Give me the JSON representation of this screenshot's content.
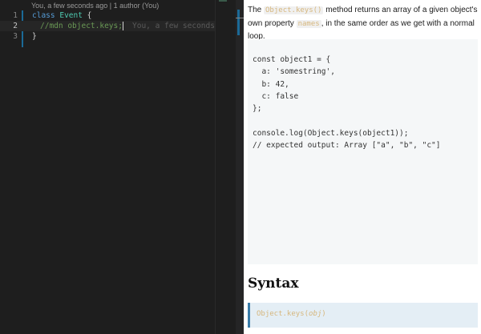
{
  "editor": {
    "blame_header": "You, a few seconds ago | 1 author (You)",
    "lines": [
      {
        "num": "1",
        "keyword": "class",
        "name": "Event",
        "rest": " {"
      },
      {
        "num": "2",
        "comment": "//mdn object.keys;",
        "inline_blame": "You, a few seconds ago"
      },
      {
        "num": "3",
        "text": "}"
      }
    ]
  },
  "doc": {
    "intro_before": "The ",
    "intro_code1": "Object.keys()",
    "intro_mid": " method returns an array of a given object's own property ",
    "intro_code2": "names",
    "intro_after": ", in the same order as we get with a normal loop.",
    "example_code": "const object1 = {\n  a: 'somestring',\n  b: 42,\n  c: false\n};\n\nconsole.log(Object.keys(object1));\n// expected output: Array [\"a\", \"b\", \"c\"]",
    "syntax_heading": "Syntax",
    "syntax_prefix": "Object.keys(",
    "syntax_arg": "obj",
    "syntax_suffix": ")"
  }
}
